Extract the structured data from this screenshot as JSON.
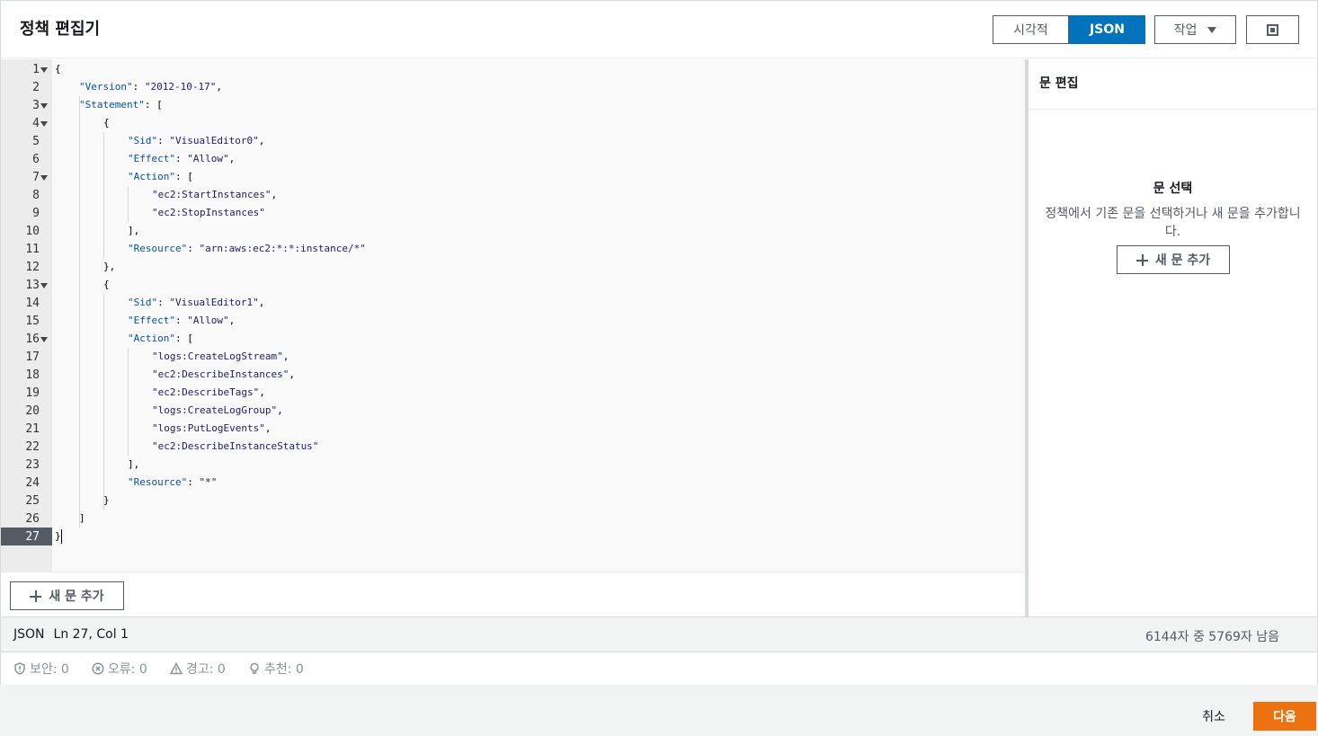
{
  "header": {
    "title": "정책 편집기",
    "tab_visual": "시각적",
    "tab_json": "JSON",
    "actions_label": "작업"
  },
  "editor": {
    "line_numbers": [
      "1",
      "2",
      "3",
      "4",
      "5",
      "6",
      "7",
      "8",
      "9",
      "10",
      "11",
      "12",
      "13",
      "14",
      "15",
      "16",
      "17",
      "18",
      "19",
      "20",
      "21",
      "22",
      "23",
      "24",
      "25",
      "26",
      "27"
    ],
    "add_statement_label": "새 문 추가"
  },
  "code": {
    "version_key": "\"Version\"",
    "version_val": "\"2012-10-17\"",
    "statement_key": "\"Statement\"",
    "sid_key": "\"Sid\"",
    "effect_key": "\"Effect\"",
    "action_key": "\"Action\"",
    "resource_key": "\"Resource\"",
    "sid0": "\"VisualEditor0\"",
    "allow": "\"Allow\"",
    "a1": "\"ec2:StartInstances\"",
    "a2": "\"ec2:StopInstances\"",
    "res0": "\"arn:aws:ec2:*:*:instance/*\"",
    "sid1": "\"VisualEditor1\"",
    "b1": "\"logs:CreateLogStream\"",
    "b2": "\"ec2:DescribeInstances\"",
    "b3": "\"ec2:DescribeTags\"",
    "b4": "\"logs:CreateLogGroup\"",
    "b5": "\"logs:PutLogEvents\"",
    "b6": "\"ec2:DescribeInstanceStatus\"",
    "res1": "\"*\""
  },
  "side": {
    "title": "문 편집",
    "empty_title": "문 선택",
    "empty_desc": "정책에서 기존 문을 선택하거나 새 문을 추가합니다.",
    "add_label": "새 문 추가"
  },
  "status": {
    "language": "JSON",
    "position": "Ln 27, Col 1",
    "remaining": "6144자 중 5769자 남음"
  },
  "lint": {
    "security": "보안: 0",
    "errors": "오류: 0",
    "warnings": "경고: 0",
    "suggestions": "추천: 0"
  },
  "footer": {
    "cancel": "취소",
    "next": "다음"
  },
  "colors": {
    "primary": "#0073bb",
    "next_button": "#ec7211"
  }
}
